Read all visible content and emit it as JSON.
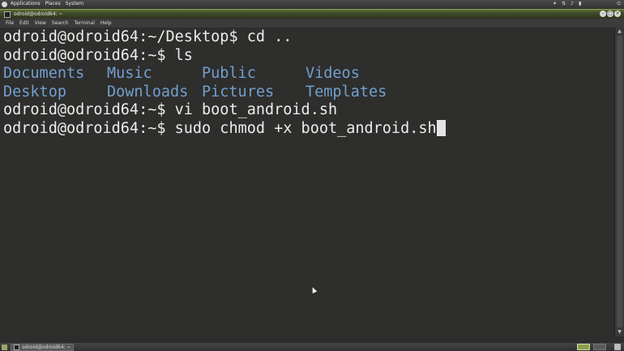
{
  "top_panel": {
    "menus": [
      "Applications",
      "Places",
      "System"
    ],
    "tray_icons": [
      "bluetooth-icon",
      "network-icon",
      "volume-icon",
      "battery-icon",
      "power-icon"
    ]
  },
  "window": {
    "title": "odroid@odroid64: ~",
    "buttons": [
      "minimize",
      "maximize",
      "close"
    ]
  },
  "menubar": {
    "items": [
      "File",
      "Edit",
      "View",
      "Search",
      "Terminal",
      "Help"
    ]
  },
  "terminal": {
    "lines": [
      "odroid@odroid64:~/Desktop$ cd ..",
      "odroid@odroid64:~$ ls"
    ],
    "ls_rows": [
      [
        "Documents",
        "Music",
        "Public",
        "Videos"
      ],
      [
        "Desktop",
        "Downloads",
        "Pictures",
        "Templates"
      ]
    ],
    "lines_after": [
      "odroid@odroid64:~$ vi boot_android.sh",
      "odroid@odroid64:~$ sudo chmod +x boot_android.sh"
    ],
    "colors": {
      "text": "#ececec",
      "directory": "#729fcf",
      "background": "#2e2e2c"
    }
  },
  "taskbar": {
    "task_label": "odroid@odroid64: ~"
  }
}
